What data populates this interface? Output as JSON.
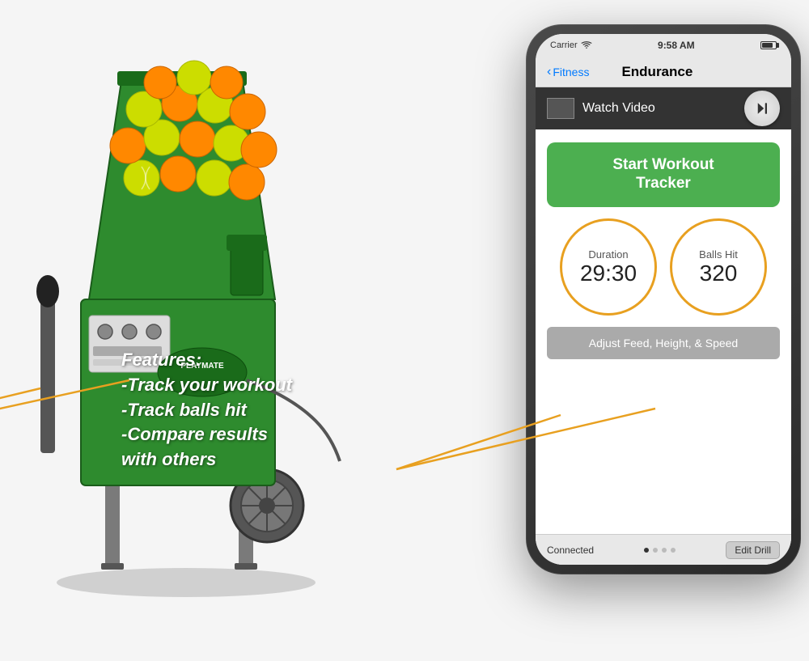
{
  "statusBar": {
    "carrier": "Carrier",
    "time": "9:58 AM",
    "wifiIcon": "wifi-icon",
    "batteryIcon": "battery-icon"
  },
  "navBar": {
    "backLabel": "Fitness",
    "title": "Endurance"
  },
  "watchVideo": {
    "label": "Watch Video"
  },
  "startWorkout": {
    "line1": "Start Workout",
    "line2": "Tracker"
  },
  "stats": {
    "duration": {
      "label": "Duration",
      "value": "29:30"
    },
    "ballsHit": {
      "label": "Balls Hit",
      "value": "320"
    }
  },
  "adjustButton": {
    "label": "Adjust Feed, Height, & Speed"
  },
  "bottomBar": {
    "connected": "Connected",
    "editDrill": "Edit Drill"
  },
  "features": {
    "line1": "Features:",
    "line2": "-Track your workout",
    "line3": "-Track balls hit",
    "line4": "-Compare results",
    "line5": "  with others"
  },
  "colors": {
    "green": "#4caf50",
    "orange": "#e8a020",
    "darkGreen": "#2e7a2e",
    "white": "#ffffff",
    "darkBg": "#2a2a2a"
  }
}
